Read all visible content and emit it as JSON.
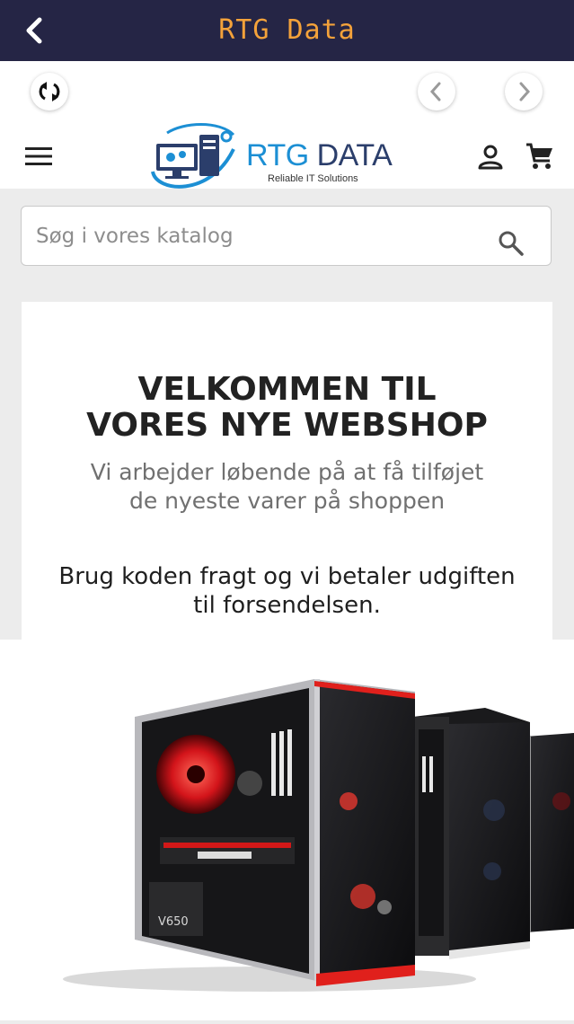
{
  "app": {
    "title": "RTG Data"
  },
  "logo": {
    "brand_rtg": "RTG",
    "brand_data": "DATA",
    "tagline": "Reliable IT Solutions"
  },
  "search": {
    "placeholder": "Søg i vores katalog",
    "value": ""
  },
  "welcome": {
    "title_line1": "VELKOMMEN TIL",
    "title_line2": "VORES NYE WEBSHOP",
    "subtitle": "Vi arbejder løbende på at få tilføjet de nyeste varer på shoppen",
    "promo": "Brug koden fragt og vi betaler udgiften til forsendelsen."
  },
  "banner": {
    "psu_label": "V650"
  },
  "colors": {
    "topbar": "#252545",
    "title": "#f4a23a",
    "accent_red": "#e0201c",
    "brand_blue": "#1c8fd4"
  }
}
